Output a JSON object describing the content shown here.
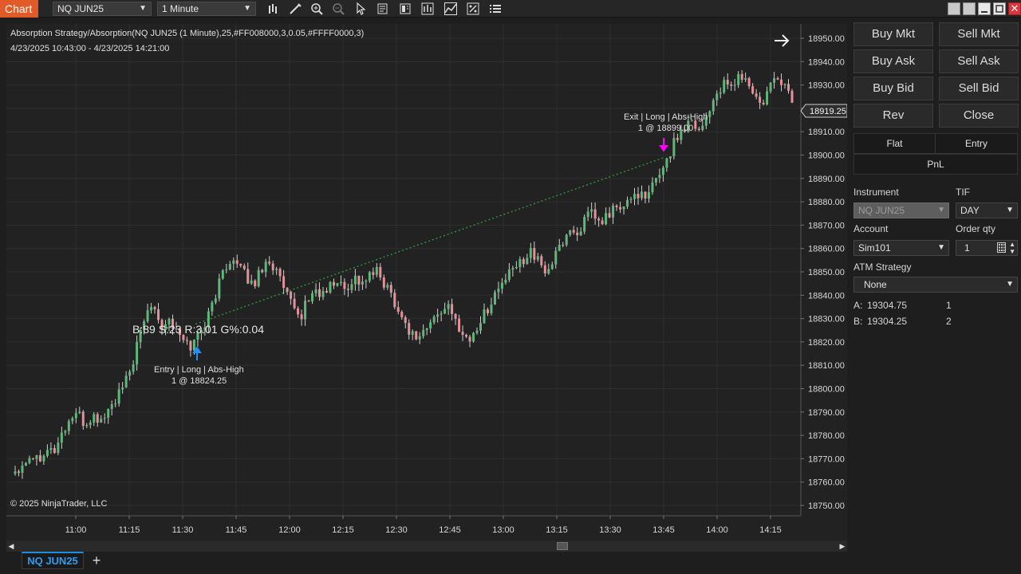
{
  "toolbar": {
    "chart_tab": "Chart",
    "instrument_select": "NQ JUN25",
    "interval_select": "1 Minute",
    "icons": [
      "bar-type-icon",
      "draw-tool-icon",
      "zoom-in-icon",
      "zoom-out-icon",
      "pointer-icon",
      "data-box-icon",
      "templates-icon",
      "indicators-icon",
      "strategies-icon",
      "properties-icon",
      "menu-icon"
    ]
  },
  "chart": {
    "title": "Absorption Strategy/Absorption(NQ JUN25 (1 Minute),25,#FF008000,3,0.05,#FFFF0000,3)",
    "date_range": "4/23/2025 10:43:00 - 4/23/2025 14:21:00",
    "copyright": "© 2025 NinjaTrader, LLC",
    "current_price": "18919.25",
    "stats_label": "B:89 S:23 R:3.01 G%:0.04",
    "entry_label_1": "Entry | Long | Abs-High",
    "entry_label_2": "1 @ 18824.25",
    "exit_label_1": "Exit | Long | Abs-High",
    "exit_label_2": "1 @ 18899.00",
    "colors": {
      "up": "#5db87a",
      "down": "#e8909a",
      "entry_arrow": "#1e90ff",
      "exit_arrow": "#ff00ff",
      "trade_line": "#2e9e3e"
    }
  },
  "chart_data": {
    "type": "candlestick",
    "ylim": [
      18745,
      18955
    ],
    "y_ticks": [
      "18950.00",
      "18940.00",
      "18930.00",
      "18920.00",
      "18910.00",
      "18900.00",
      "18890.00",
      "18880.00",
      "18870.00",
      "18860.00",
      "18850.00",
      "18840.00",
      "18830.00",
      "18820.00",
      "18810.00",
      "18800.00",
      "18790.00",
      "18780.00",
      "18770.00",
      "18760.00",
      "18750.00"
    ],
    "x_ticks": [
      "11:00",
      "11:15",
      "11:30",
      "11:45",
      "12:00",
      "12:15",
      "12:30",
      "12:45",
      "13:00",
      "13:15",
      "13:30",
      "13:45",
      "14:00",
      "14:15"
    ],
    "x_start": "10:43",
    "close_path": [
      18765,
      18768,
      18772,
      18770,
      18775,
      18773,
      18780,
      18786,
      18790,
      18784,
      18788,
      18786,
      18790,
      18795,
      18800,
      18808,
      18820,
      18832,
      18838,
      18826,
      18830,
      18824,
      18820,
      18818,
      18825,
      18830,
      18840,
      18850,
      18856,
      18852,
      18848,
      18844,
      18852,
      18855,
      18850,
      18842,
      18835,
      18830,
      18838,
      18842,
      18840,
      18844,
      18846,
      18842,
      18848,
      18845,
      18848,
      18850,
      18845,
      18840,
      18832,
      18826,
      18822,
      18824,
      18828,
      18832,
      18836,
      18830,
      18825,
      18820,
      18826,
      18832,
      18838,
      18844,
      18848,
      18852,
      18855,
      18860,
      18854,
      18850,
      18855,
      18862,
      18868,
      18866,
      18872,
      18875,
      18870,
      18874,
      18878,
      18876,
      18882,
      18884,
      18880,
      18888,
      18894,
      18900,
      18908,
      18912,
      18916,
      18910,
      18918,
      18925,
      18930,
      18928,
      18934,
      18932,
      18926,
      18920,
      18928,
      18934,
      18930,
      18924
    ]
  },
  "side": {
    "buy_mkt": "Buy Mkt",
    "sell_mkt": "Sell Mkt",
    "buy_ask": "Buy Ask",
    "sell_ask": "Sell Ask",
    "buy_bid": "Buy Bid",
    "sell_bid": "Sell Bid",
    "rev": "Rev",
    "close": "Close",
    "flat": "Flat",
    "entry": "Entry",
    "pnl": "PnL",
    "instrument_label": "Instrument",
    "instrument_value": "NQ JUN25",
    "tif_label": "TIF",
    "tif_value": "DAY",
    "account_label": "Account",
    "account_value": "Sim101",
    "order_qty_label": "Order qty",
    "order_qty_value": "1",
    "atm_label": "ATM Strategy",
    "atm_value": "None",
    "ask_label": "A:",
    "ask_price": "19304.75",
    "ask_size": "1",
    "bid_label": "B:",
    "bid_price": "19304.25",
    "bid_size": "2"
  },
  "bottom": {
    "instrument_tab": "NQ JUN25",
    "add_tab": "+"
  }
}
